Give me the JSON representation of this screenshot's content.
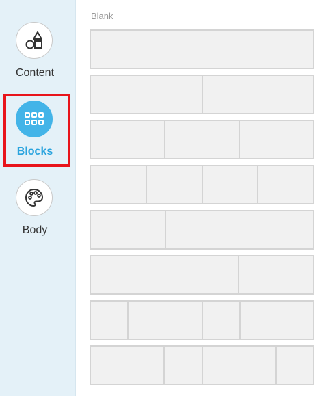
{
  "sidebar": {
    "items": [
      {
        "label": "Content",
        "icon": "shapes-icon",
        "active": false
      },
      {
        "label": "Blocks",
        "icon": "grid-icon",
        "active": true
      },
      {
        "label": "Body",
        "icon": "palette-icon",
        "active": false
      }
    ]
  },
  "blocks": {
    "section_label": "Blank",
    "rows": [
      {
        "columns": [
          1
        ]
      },
      {
        "columns": [
          1,
          1
        ]
      },
      {
        "columns": [
          1,
          1,
          1
        ]
      },
      {
        "columns": [
          1,
          1,
          1,
          1
        ]
      },
      {
        "columns": [
          1,
          2
        ]
      },
      {
        "columns": [
          2,
          1
        ]
      },
      {
        "columns": [
          1,
          2,
          1,
          2
        ]
      },
      {
        "columns": [
          2,
          1,
          2,
          1
        ]
      }
    ]
  },
  "colors": {
    "sidebar_bg": "#e4f1f8",
    "accent": "#43b4e8",
    "accent_text": "#2aa4de",
    "highlight": "#e8141b"
  }
}
